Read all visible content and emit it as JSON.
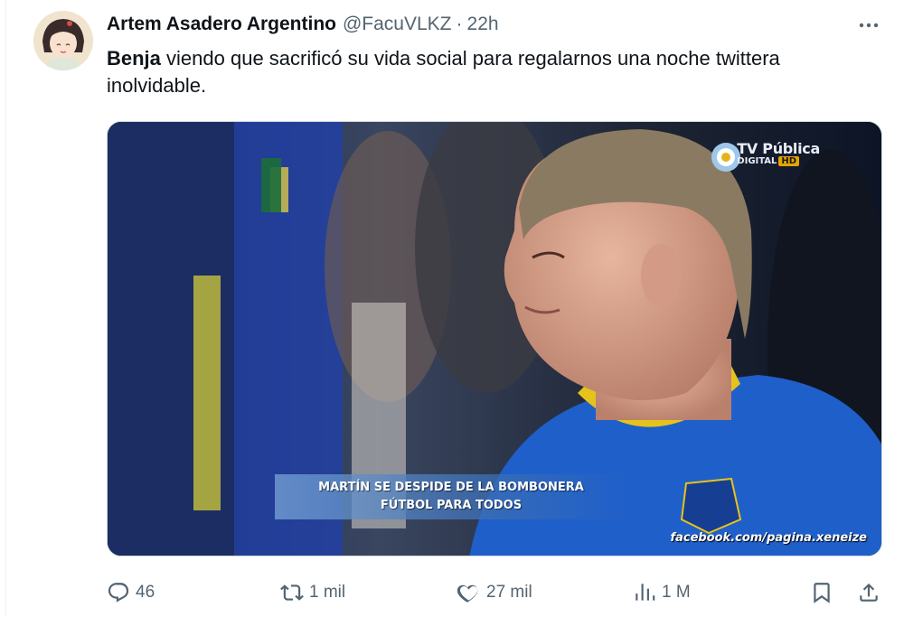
{
  "tweet": {
    "author": {
      "display_name": "Artem Asadero Argentino",
      "handle": "@FacuVLKZ",
      "separator": "·",
      "time": "22h"
    },
    "text": {
      "mention": "Benja",
      "body": " viendo que sacrificó su vida social para regalarnos una noche twittera inolvidable."
    },
    "media": {
      "broadcaster_name": "TV Pública",
      "broadcaster_sub": "DIGITAL",
      "broadcaster_hd": "HD",
      "caption_line1": "MARTÍN SE DESPIDE DE LA BOMBONERA",
      "caption_line2": "FÚTBOL PARA TODOS",
      "watermark": "facebook.com/pagina.xeneize"
    },
    "actions": {
      "replies": "46",
      "retweets": "1 mil",
      "likes": "27 mil",
      "views": "1 M"
    },
    "icons": {
      "more": "more-icon",
      "reply": "reply-icon",
      "retweet": "retweet-icon",
      "like": "heart-icon",
      "views": "views-icon",
      "bookmark": "bookmark-icon",
      "share": "share-icon"
    },
    "colors": {
      "text_primary": "#0f1419",
      "text_secondary": "#536471",
      "border": "#cfd9de"
    }
  }
}
